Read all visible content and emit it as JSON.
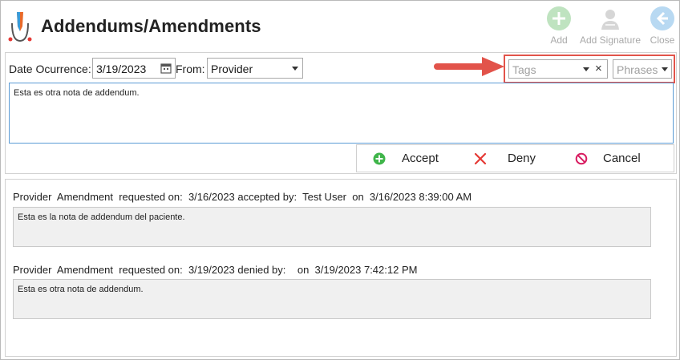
{
  "header": {
    "title": "Addendums/Amendments",
    "buttons": {
      "add": "Add",
      "add_signature": "Add Signature",
      "close": "Close"
    }
  },
  "form": {
    "date_label": "Date Ocurrence:",
    "date_value": "3/19/2023",
    "from_label": "From:",
    "from_value": "Provider",
    "tags_placeholder": "Tags",
    "tags_clear": "×",
    "phrases_placeholder": "Phrases",
    "note_text": "Esta es otra nota de addendum."
  },
  "actions": {
    "accept": "Accept",
    "deny": "Deny",
    "cancel": "Cancel"
  },
  "history": [
    {
      "header": "Provider  Amendment  requested on:  3/16/2023 accepted by:  Test User  on  3/16/2023 8:39:00 AM",
      "text": "Esta es la nota de addendum del paciente."
    },
    {
      "header": "Provider  Amendment  requested on:  3/19/2023 denied by:    on  3/19/2023 7:42:12 PM",
      "text": "Esta es otra nota de addendum."
    }
  ],
  "colors": {
    "highlight": "#e2534a",
    "accept": "#3fb54a",
    "deny": "#e53935",
    "cancel": "#d81b60",
    "disabled_icon": "#bfe3c0"
  },
  "icons": {
    "logo": "pen-nib-logo-icon",
    "add": "plus-circle-icon",
    "add_signature": "person-signature-icon",
    "close": "arrow-left-circle-icon",
    "calendar": "calendar-icon",
    "accept": "plus-circle-icon",
    "deny": "x-icon",
    "cancel": "prohibited-icon"
  }
}
